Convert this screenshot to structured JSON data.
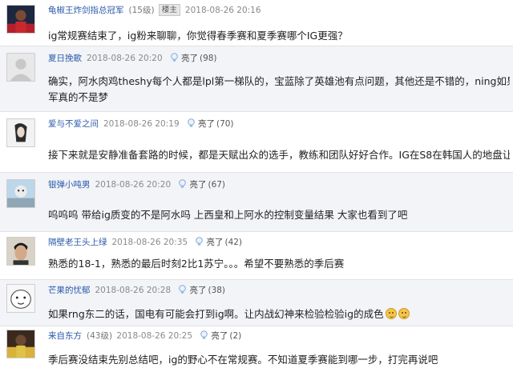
{
  "icons": {
    "like": "lightbulb-icon",
    "emoji": "smiley-face-icon"
  },
  "colors": {
    "username": "#2a5aa8",
    "timestamp": "#8a8a8a",
    "alt_row": "#f2f4f8"
  },
  "posts": [
    {
      "user": "龟椒王炸剑指总冠军",
      "level": "(15级)",
      "badge": "楼主",
      "time": "2018-08-26 20:16",
      "text": "ig常规赛结束了，ig粉来聊聊，你觉得春季赛和夏季赛哪个IG更强？"
    },
    {
      "user": "夏日挽歌",
      "time": "2018-08-26 20:20",
      "like_label": "亮了",
      "like_count": "(98)",
      "text": "确实，阿水肉鸡theshy每个人都是lpl第一梯队的，宝蓝除了英雄池有点问题，其他还是不错的，ning如果能打好中野联动我觉得亚军真的不是梦",
      "text_line1": "确实，阿水肉鸡theshy每个人都是lpl第一梯队的，宝蓝除了英雄池有点问题，其他还是不错的，ning如果",
      "text_line2": "军真的不是梦"
    },
    {
      "user": "爱与不爱之间",
      "time": "2018-08-26 20:19",
      "like_label": "亮了",
      "like_count": "(70)",
      "text": "接下来就是安静准备套路的时候，都是天赋出众的选手，教练和团队好好合作。IG在S8在韩国人的地盘让"
    },
    {
      "user": "银弹小吨男",
      "time": "2018-08-26 20:20",
      "like_label": "亮了",
      "like_count": "(67)",
      "text": "呜呜呜 带给ig质变的不是阿水吗 上西皇和上阿水的控制变量结果 大家也看到了吧"
    },
    {
      "user": "隔壁老王头上绿",
      "time": "2018-08-26 20:35",
      "like_label": "亮了",
      "like_count": "(42)",
      "text": "熟悉的18-1，熟悉的最后时刻2比1苏宁。。。希望不要熟悉的季后赛"
    },
    {
      "user": "芒果的忧郁",
      "time": "2018-08-26 20:28",
      "like_label": "亮了",
      "like_count": "(38)",
      "text": "如果rng东二的话，国电有可能会打到ig啊。让内战幻神来检验检验ig的成色"
    },
    {
      "user": "来自东方",
      "level": "(43级)",
      "time": "2018-08-26 20:25",
      "like_label": "亮了",
      "like_count": "(2)",
      "text": "季后赛没结束先别总结吧，ig的野心不在常规赛。不知道夏季赛能到哪一步，打完再说吧"
    }
  ]
}
